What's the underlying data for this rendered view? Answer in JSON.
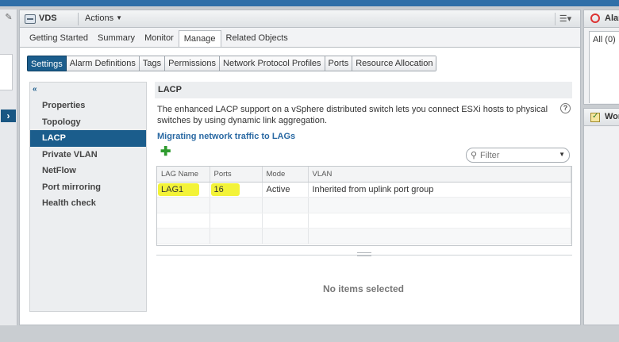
{
  "object": {
    "title": "VDS",
    "actions_label": "Actions"
  },
  "main_tabs": [
    {
      "label": "Getting Started",
      "active": false
    },
    {
      "label": "Summary",
      "active": false
    },
    {
      "label": "Monitor",
      "active": false
    },
    {
      "label": "Manage",
      "active": true
    },
    {
      "label": "Related Objects",
      "active": false
    }
  ],
  "sub_tabs": [
    {
      "label": "Settings",
      "active": true
    },
    {
      "label": "Alarm Definitions",
      "active": false
    },
    {
      "label": "Tags",
      "active": false
    },
    {
      "label": "Permissions",
      "active": false
    },
    {
      "label": "Network Protocol Profiles",
      "active": false
    },
    {
      "label": "Ports",
      "active": false
    },
    {
      "label": "Resource Allocation",
      "active": false
    }
  ],
  "left_nav": {
    "collapse_glyph": "«",
    "items": [
      {
        "label": "Properties",
        "active": false
      },
      {
        "label": "Topology",
        "active": false
      },
      {
        "label": "LACP",
        "active": true
      },
      {
        "label": "Private VLAN",
        "active": false
      },
      {
        "label": "NetFlow",
        "active": false
      },
      {
        "label": "Port mirroring",
        "active": false
      },
      {
        "label": "Health check",
        "active": false
      }
    ]
  },
  "lacp": {
    "header": "LACP",
    "description": "The enhanced LACP support on a vSphere distributed switch lets you connect ESXi hosts to physical switches by using dynamic link aggregation.",
    "link": "Migrating network traffic to LAGs",
    "filter_placeholder": "Filter",
    "columns": [
      "LAG Name",
      "Ports",
      "Mode",
      "VLAN"
    ],
    "rows": [
      {
        "lag_name": "LAG1",
        "ports": "16",
        "mode": "Active",
        "vlan": "Inherited from uplink port group"
      }
    ],
    "no_selection": "No items selected"
  },
  "right_panels": {
    "alarms_label": "Alar",
    "alarms_tab": "All (0)",
    "work_label": "Wor"
  },
  "icons": {
    "pin": "pin-icon",
    "expand": "expand-icon",
    "add": "add-icon",
    "search": "search-icon",
    "help": "help-icon",
    "alarm": "alarm-icon",
    "tasks": "work-in-progress-icon"
  },
  "colors": {
    "accent": "#1b5d8c",
    "link": "#2a69a3",
    "highlight": "#f3f338",
    "add": "#2e9b2e"
  }
}
